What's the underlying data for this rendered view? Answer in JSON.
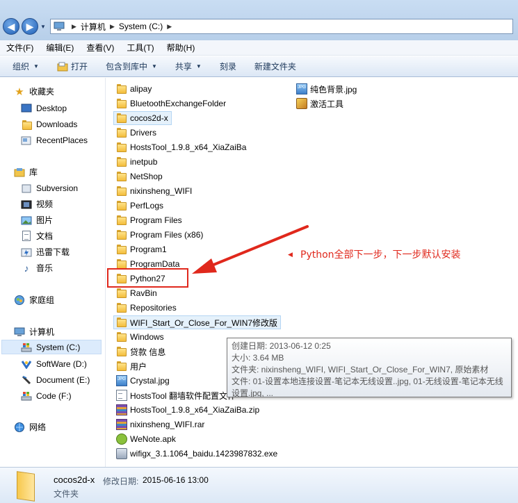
{
  "address": {
    "segments": [
      "计算机",
      "System (C:)"
    ]
  },
  "menu": {
    "items": [
      "文件(F)",
      "编辑(E)",
      "查看(V)",
      "工具(T)",
      "帮助(H)"
    ]
  },
  "toolbar": {
    "organize": "组织",
    "open": "打开",
    "include_in_library": "包含到库中",
    "share": "共享",
    "burn": "刻录",
    "new_folder": "新建文件夹"
  },
  "nav": {
    "favorites": "收藏夹",
    "desktop": "Desktop",
    "downloads": "Downloads",
    "recent": "RecentPlaces",
    "libraries": "库",
    "subversion": "Subversion",
    "videos": "视频",
    "pictures": "图片",
    "documents": "文档",
    "thunder": "迅雷下载",
    "music": "音乐",
    "homegroup": "家庭组",
    "computer": "计算机",
    "system_c": "System (C:)",
    "software_d": "SoftWare (D:)",
    "document_e": "Document (E:)",
    "code_f": "Code (F:)",
    "network": "网络"
  },
  "files": {
    "col1": [
      "alipay",
      "BluetoothExchangeFolder",
      "cocos2d-x",
      "Drivers",
      "HostsTool_1.9.8_x64_XiaZaiBa",
      "inetpub",
      "NetShop",
      "nixinsheng_WIFI",
      "PerfLogs",
      "Program Files",
      "Program Files (x86)",
      "Program1",
      "ProgramData",
      "Python27",
      "RavBin",
      "Repositories",
      "WIFI_Start_Or_Close_For_WIN7修改版",
      "Windows",
      "贷款 信息",
      "用户",
      "Crystal.jpg",
      "HostsTool 翻墙软件配置文件",
      "HostsTool_1.9.8_x64_XiaZaiBa.zip",
      "nixinsheng_WIFI.rar",
      "WeNote.apk",
      "wifigx_3.1.1064_baidu.1423987832.exe"
    ],
    "col2": [
      "纯色背景.jpg",
      "激活工具"
    ]
  },
  "annotation": {
    "text": "Python全部下一步，下一步默认安装",
    "color": "#e0281c"
  },
  "tooltip": {
    "line1": "创建日期: 2013-06-12 0:25",
    "line2": "大小: 3.64 MB",
    "line3": "文件夹: nixinsheng_WIFI, WIFI_Start_Or_Close_For_WIN7, 原始素材",
    "line4": "文件: 01-设置本地连接设置-笔记本无线设置..jpg, 01-无线设置-笔记本无线",
    "line5": "设置.jpg, ..."
  },
  "details": {
    "name": "cocos2d-x",
    "date_label": "修改日期:",
    "date_value": "2015-06-16 13:00",
    "type": "文件夹"
  }
}
